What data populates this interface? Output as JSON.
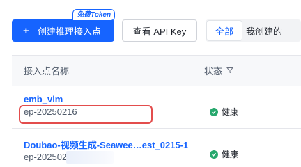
{
  "toolbar": {
    "create_label": "创建推理接入点",
    "create_icon": "plus-icon",
    "free_badge": "免费Token",
    "api_key_label": "查看 API Key",
    "filter_tabs": [
      "全部",
      "我创建的"
    ],
    "active_tab": "全部"
  },
  "table": {
    "headers": {
      "name": "接入点名称",
      "status": "状态"
    },
    "rows": [
      {
        "name": "emb_vlm",
        "id": "ep-20250216",
        "status": "健康",
        "status_icon": "check-circle-icon"
      },
      {
        "name": "Doubao-视频生成-Seawee…est_0215-1",
        "id": "ep-20250215",
        "status": "健康",
        "status_icon": "check-circle-icon"
      }
    ]
  },
  "colors": {
    "primary": "#1664ff",
    "healthy": "#27a86d",
    "highlight": "#e34d4d"
  }
}
